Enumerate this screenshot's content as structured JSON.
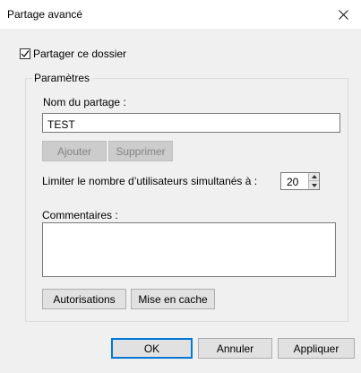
{
  "window": {
    "title": "Partage avancé",
    "close_icon": "close-icon"
  },
  "share_checkbox": {
    "label": "Partager ce dossier",
    "checked": true
  },
  "settings": {
    "legend": "Paramètres",
    "share_name_label": "Nom du partage :",
    "share_name_value": "TEST",
    "add_button": "Ajouter",
    "remove_button": "Supprimer",
    "limit_label": "Limiter le nombre d’utilisateurs simultanés à :",
    "limit_value": "20",
    "comments_label": "Commentaires :",
    "comments_value": ""
  },
  "actions": {
    "permissions_button": "Autorisations",
    "caching_button": "Mise en cache"
  },
  "footer": {
    "ok_button": "OK",
    "cancel_button": "Annuler",
    "apply_button": "Appliquer"
  },
  "colors": {
    "dialog_bg": "#f0f0f0",
    "default_button_border": "#0078d7"
  }
}
